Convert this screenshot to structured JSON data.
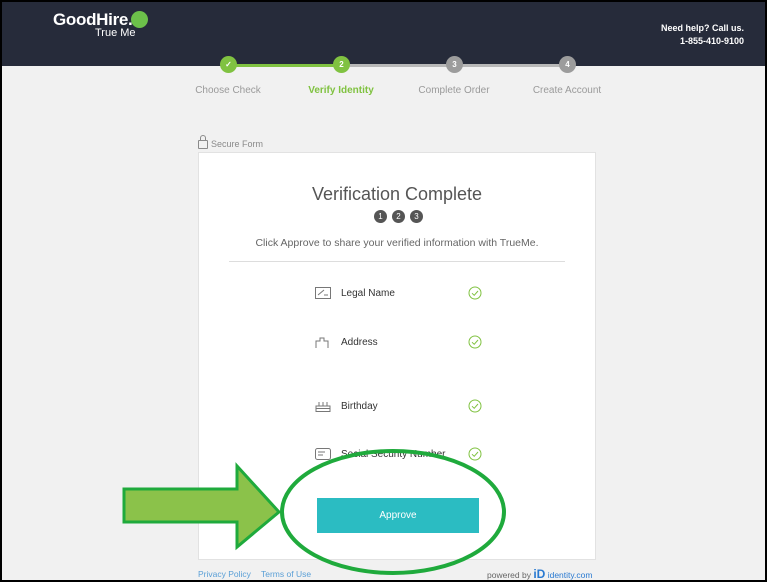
{
  "header": {
    "logo_text": "GoodHire.",
    "logo_sub": "True Me",
    "help_line1": "Need help? Call us.",
    "help_line2": "1-855-410-9100"
  },
  "steps": [
    {
      "label": "Choose Check",
      "marker": "✓",
      "state": "done"
    },
    {
      "label": "Verify Identity",
      "marker": "2",
      "state": "active"
    },
    {
      "label": "Complete Order",
      "marker": "3",
      "state": "pending"
    },
    {
      "label": "Create Account",
      "marker": "4",
      "state": "pending"
    }
  ],
  "secure_label": "Secure Form",
  "card": {
    "title": "Verification Complete",
    "mini_steps": [
      "1",
      "2",
      "3"
    ],
    "subtitle": "Click Approve to share your verified information with TrueMe.",
    "fields": [
      {
        "label": "Legal Name",
        "icon": "id-card-icon"
      },
      {
        "label": "Address",
        "icon": "building-icon"
      },
      {
        "label": "Birthday",
        "icon": "cake-icon"
      },
      {
        "label": "Social Security Number",
        "icon": "card-icon"
      }
    ],
    "approve_label": "Approve"
  },
  "footer": {
    "privacy": "Privacy Policy",
    "terms": "Terms of Use",
    "powered_by": "powered by",
    "id_brand": "identity.com"
  },
  "colors": {
    "header_bg": "#262b3a",
    "accent_green": "#80c241",
    "button_teal": "#2bbcc2",
    "annotation_green": "#1faa3c",
    "arrow_fill": "#8bc24a"
  }
}
